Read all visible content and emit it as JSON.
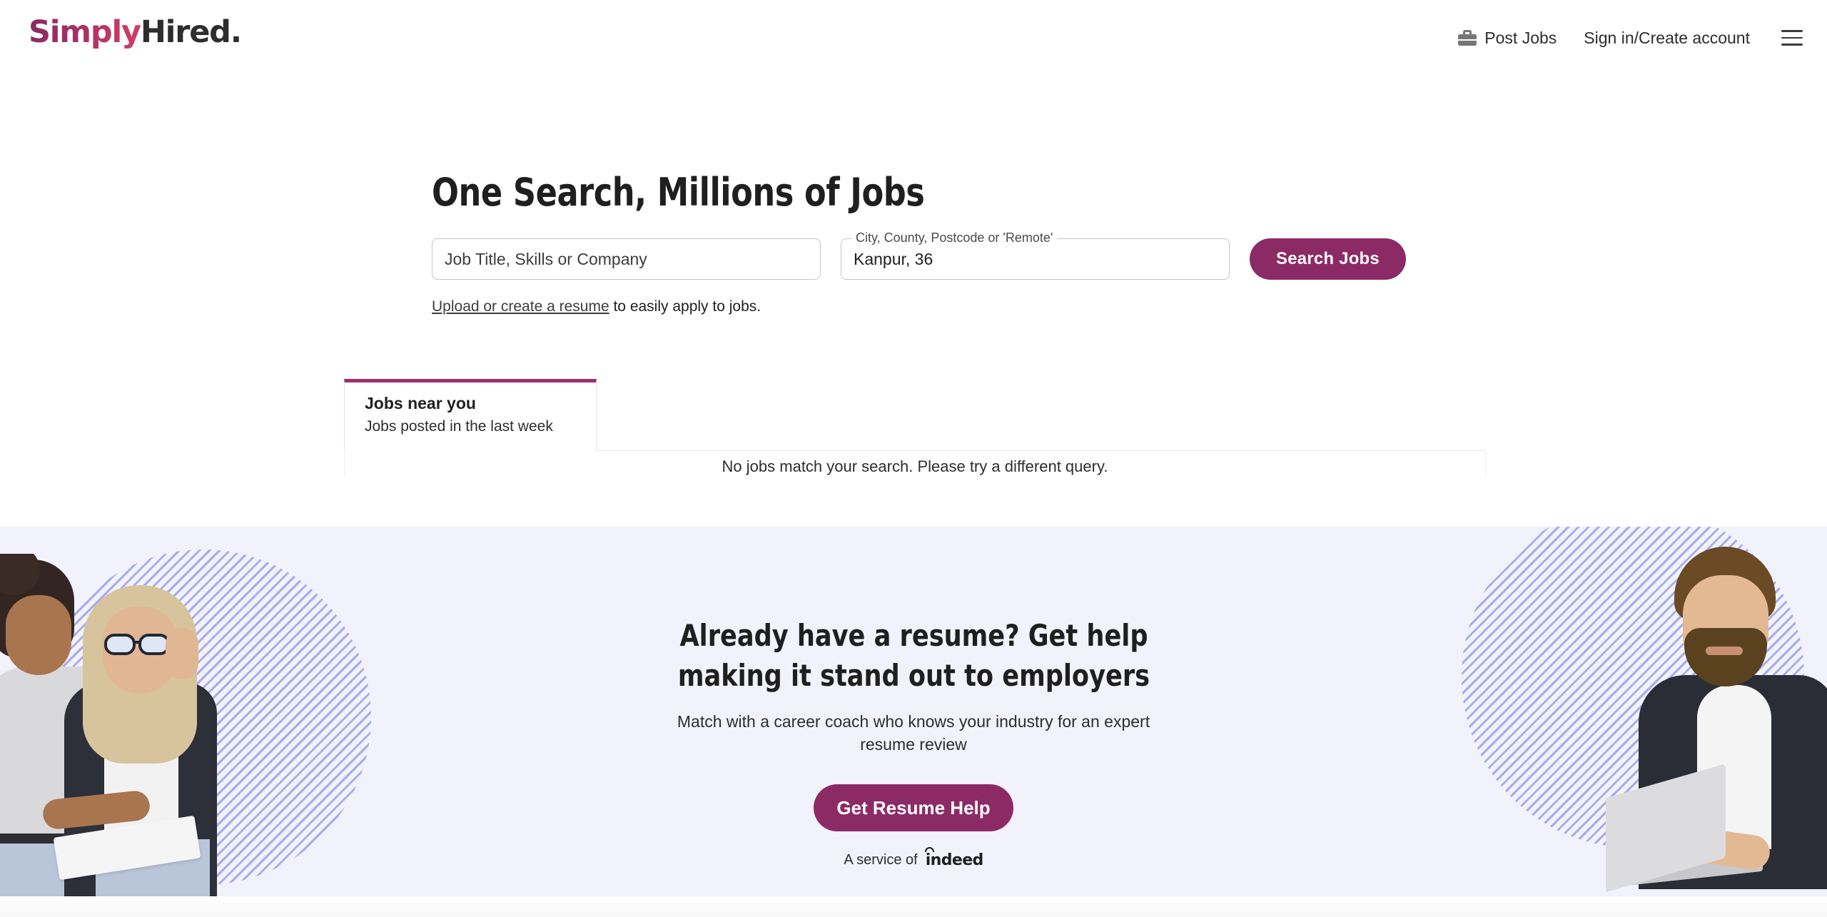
{
  "header": {
    "logo": {
      "part1": "Simply",
      "part2": "Hired."
    },
    "post_jobs_label": "Post Jobs",
    "signin_label": "Sign in/Create account",
    "briefcase_icon": "briefcase-icon",
    "menu_icon": "hamburger-menu-icon",
    "brand_color": "#a93067"
  },
  "hero": {
    "title": "One Search, Millions of Jobs",
    "what_placeholder": "Job Title, Skills or Company",
    "what_value": "",
    "where_label": "City, County, Postcode or 'Remote'",
    "where_value": "Kanpur, 36",
    "search_button": "Search Jobs",
    "resume_link": "Upload or create a resume",
    "resume_rest": " to easily apply to jobs.",
    "button_color": "#8c2a66"
  },
  "tabs": {
    "active": {
      "title": "Jobs near you",
      "subtitle": "Jobs posted in the last week"
    },
    "active_indicator_color": "#9b3071"
  },
  "results": {
    "empty_message": "No jobs match your search. Please try a different query."
  },
  "banner": {
    "title_line1": "Already have a resume? Get help",
    "title_line2": "making it stand out to employers",
    "subtitle_line1": "Match with a career coach who knows your industry for an expert",
    "subtitle_line2": "resume review",
    "cta_label": "Get Resume Help",
    "service_prefix": "A service of",
    "service_brand": "indeed",
    "background_color": "#f2f2fd",
    "cta_color": "#8c2a66"
  }
}
